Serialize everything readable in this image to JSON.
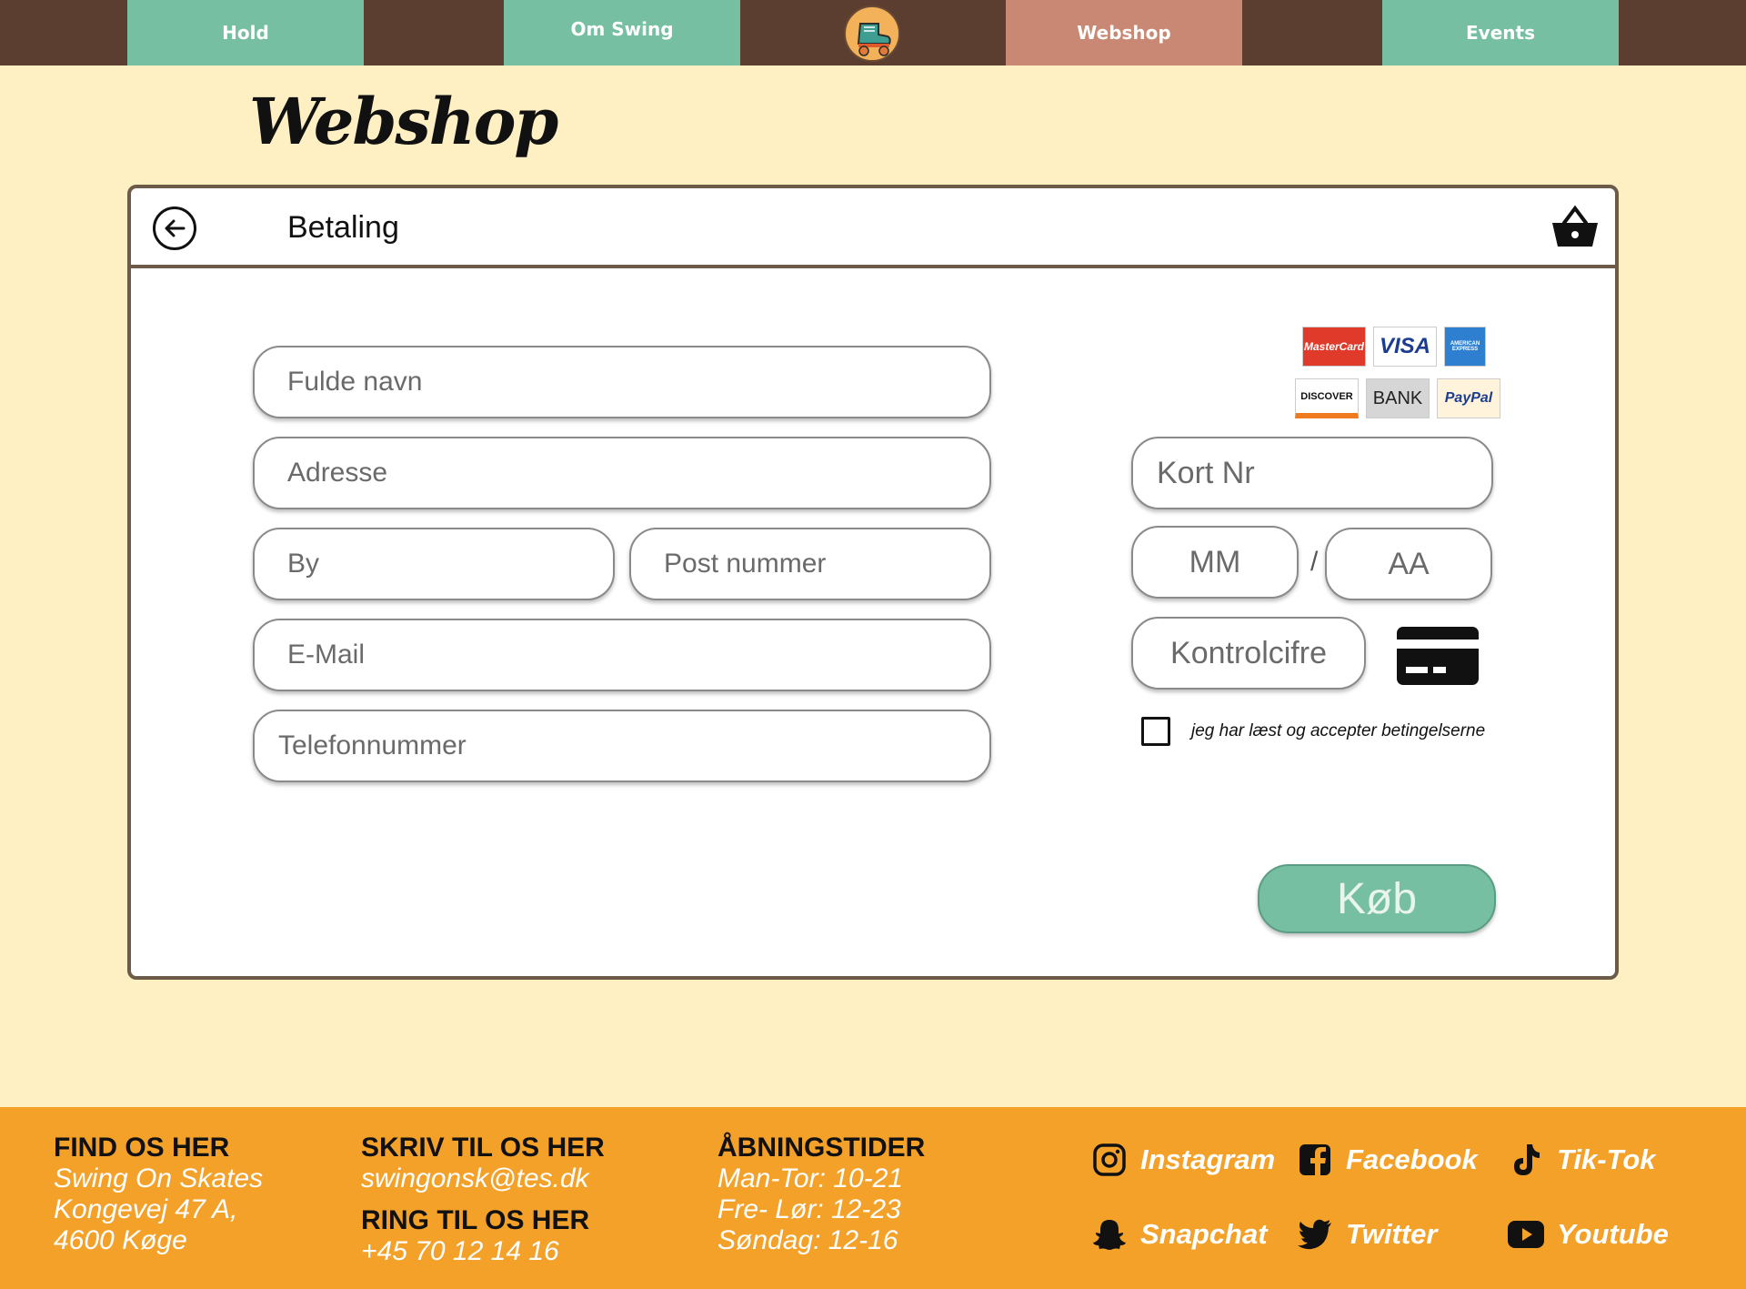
{
  "nav": {
    "items": [
      {
        "label": "Hold"
      },
      {
        "label": "Om Swing"
      },
      {
        "label": "Webshop"
      },
      {
        "label": "Events"
      }
    ],
    "logo_icon": "roller-skate-icon"
  },
  "page": {
    "title": "Webshop"
  },
  "checkout": {
    "header_title": "Betaling",
    "back_icon": "arrow-left-circle-icon",
    "basket_icon": "shopping-basket-icon",
    "fields": {
      "full_name": "Fulde navn",
      "address": "Adresse",
      "city": "By",
      "postal": "Post nummer",
      "email": "E-Mail",
      "phone": "Telefonnummer",
      "card_number": "Kort Nr",
      "month": "MM",
      "year": "AA",
      "cvc": "Kontrolcifre"
    },
    "payment_logos": [
      "MasterCard",
      "VISA",
      "AMERICAN EXPRESS",
      "DISCOVER",
      "BANK",
      "PayPal"
    ],
    "expiry_separator": "/",
    "card_icon": "credit-card-icon",
    "terms_label": "jeg har læst og accepter betingelserne",
    "buy_label": "Køb",
    "colors": {
      "accent": "#77bfa2",
      "active_nav": "#c98873",
      "nav_bg": "#5b3e2f",
      "page_bg": "#fff0c4"
    }
  },
  "footer": {
    "find": {
      "heading": "FIND OS HER",
      "lines": [
        "Swing On Skates",
        "Kongevej 47 A,",
        "4600 Køge"
      ]
    },
    "write": {
      "heading": "SKRIV TIL OS HER",
      "email": "swingonsk@tes.dk"
    },
    "call": {
      "heading": "RING TIL OS HER",
      "phone": "+45 70 12 14 16"
    },
    "hours": {
      "heading": "ÅBNINGSTIDER",
      "lines": [
        "Man-Tor: 10-21",
        "Fre- Lør: 12-23",
        "Søndag: 12-16"
      ]
    },
    "social": [
      {
        "label": "Instagram",
        "icon": "instagram-icon"
      },
      {
        "label": "Facebook",
        "icon": "facebook-icon"
      },
      {
        "label": "Tik-Tok",
        "icon": "tiktok-icon"
      },
      {
        "label": "Snapchat",
        "icon": "snapchat-icon"
      },
      {
        "label": "Twitter",
        "icon": "twitter-icon"
      },
      {
        "label": "Youtube",
        "icon": "youtube-icon"
      }
    ],
    "bg_color": "#f4a12a"
  }
}
